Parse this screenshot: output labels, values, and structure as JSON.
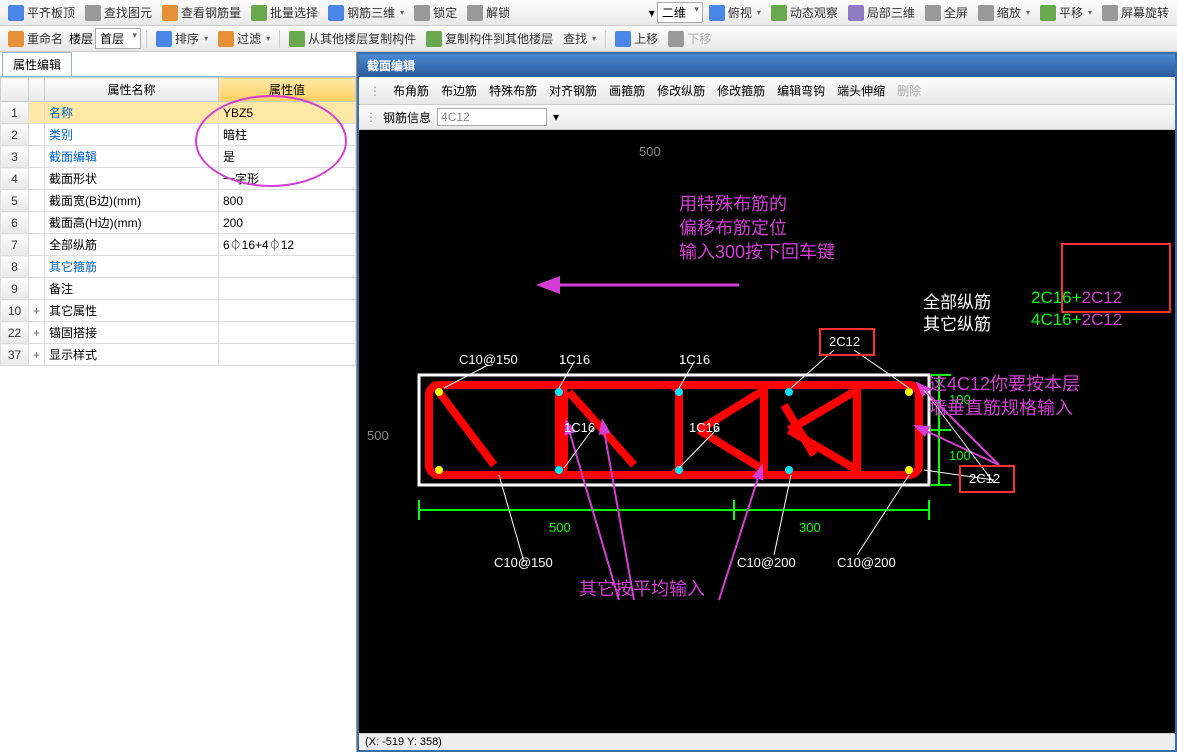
{
  "toolbar1": {
    "btns": [
      "平齐板顶",
      "查找图元",
      "查看钢筋量",
      "批量选择",
      "钢筋三维",
      "锁定",
      "解锁"
    ],
    "right": [
      "二维",
      "俯视",
      "动态观察",
      "局部三维",
      "全屏",
      "缩放",
      "平移",
      "屏幕旋转"
    ]
  },
  "toolbar2": {
    "rename": "重命名",
    "floor": "楼层",
    "floorval": "首层",
    "sort": "排序",
    "filter": "过滤",
    "copyfrom": "从其他楼层复制构件",
    "copyto": "复制构件到其他楼层",
    "find": "查找",
    "up": "上移",
    "down": "下移"
  },
  "proptab": "属性编辑",
  "grid": {
    "h1": "属性名称",
    "h2": "属性值",
    "rows": [
      {
        "n": "1",
        "a": "名称",
        "v": "YBZ5",
        "blue": true,
        "sel": true
      },
      {
        "n": "2",
        "a": "类别",
        "v": "暗柱",
        "blue": true
      },
      {
        "n": "3",
        "a": "截面编辑",
        "v": "是",
        "blue": true
      },
      {
        "n": "4",
        "a": "截面形状",
        "v": "一字形"
      },
      {
        "n": "5",
        "a": "截面宽(B边)(mm)",
        "v": "800"
      },
      {
        "n": "6",
        "a": "截面高(H边)(mm)",
        "v": "200"
      },
      {
        "n": "7",
        "a": "全部纵筋",
        "v": "6⏀16+4⏀12"
      },
      {
        "n": "8",
        "a": "其它箍筋",
        "v": "",
        "blue": true
      },
      {
        "n": "9",
        "a": "备注",
        "v": ""
      },
      {
        "n": "10",
        "a": "其它属性",
        "v": "",
        "exp": "+"
      },
      {
        "n": "22",
        "a": "锚固搭接",
        "v": "",
        "exp": "+"
      },
      {
        "n": "37",
        "a": "显示样式",
        "v": "",
        "exp": "+"
      }
    ]
  },
  "section": {
    "title": "截面编辑",
    "tools": [
      "布角筋",
      "布边筋",
      "特殊布筋",
      "对齐钢筋",
      "画箍筋",
      "修改纵筋",
      "修改箍筋",
      "编辑弯钩",
      "端头伸缩",
      "删除"
    ],
    "infolabel": "钢筋信息",
    "infoval": "4C12"
  },
  "status": "(X: -519 Y: 358)",
  "canvas": {
    "note1a": "用特殊布筋的",
    "note1b": "偏移布筋定位",
    "note1c": "输入300按下回车键",
    "allbar": "全部纵筋",
    "otherbar": "其它纵筋",
    "barspec1a": "2C16+",
    "barspec1b": "2C12",
    "barspec2a": "4C16+",
    "barspec2b": "2C12",
    "note2a": "这4C12你要按本层",
    "note2b": "墙垂直筋规格输入",
    "avg": "其它按平均输入",
    "c10_150a": "C10@150",
    "c10_150b": "C10@150",
    "l1c16a": "1C16",
    "l1c16b": "1C16",
    "l1c16c": "1C16",
    "l1c16d": "1C16",
    "l2c12a": "2C12",
    "l2c12b": "2C12",
    "c10_200a": "C10@200",
    "c10_200b": "C10@200",
    "d500": "500",
    "d300": "300",
    "d100a": "100",
    "d100b": "100",
    "axis500": "500"
  }
}
